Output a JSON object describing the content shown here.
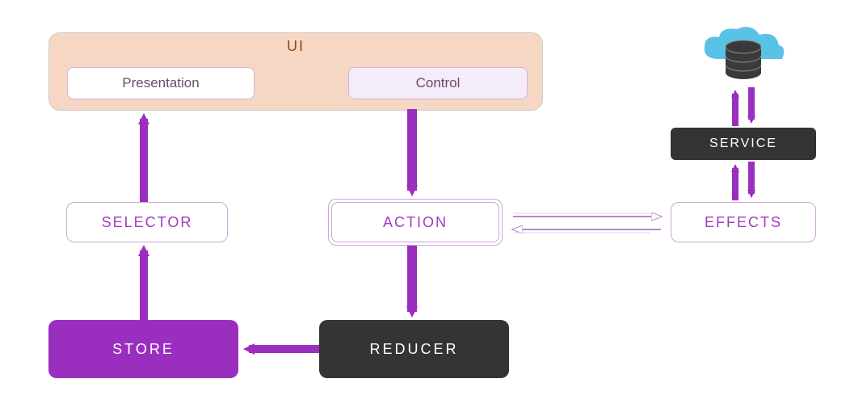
{
  "ui": {
    "title": "UI",
    "presentation": "Presentation",
    "control": "Control"
  },
  "nodes": {
    "selector": "SELECTOR",
    "action": "ACTION",
    "store": "STORE",
    "reducer": "REDUCER",
    "effects": "EFFECTS",
    "service": "SERVICE"
  },
  "colors": {
    "purple": "#9a2fbf",
    "dark": "#343434",
    "ui_bg": "#f6d7c4",
    "cloud": "#5bc2e7"
  },
  "flow": [
    {
      "from": "control",
      "to": "action",
      "style": "solid-purple"
    },
    {
      "from": "action",
      "to": "reducer",
      "style": "solid-purple"
    },
    {
      "from": "reducer",
      "to": "store",
      "style": "solid-purple"
    },
    {
      "from": "store",
      "to": "selector",
      "style": "solid-purple"
    },
    {
      "from": "selector",
      "to": "presentation",
      "style": "solid-purple"
    },
    {
      "from": "action",
      "to": "effects",
      "style": "bidirectional-outline"
    },
    {
      "from": "effects",
      "to": "service",
      "style": "bidirectional-purple"
    },
    {
      "from": "service",
      "to": "cloud-db",
      "style": "bidirectional-purple"
    }
  ]
}
